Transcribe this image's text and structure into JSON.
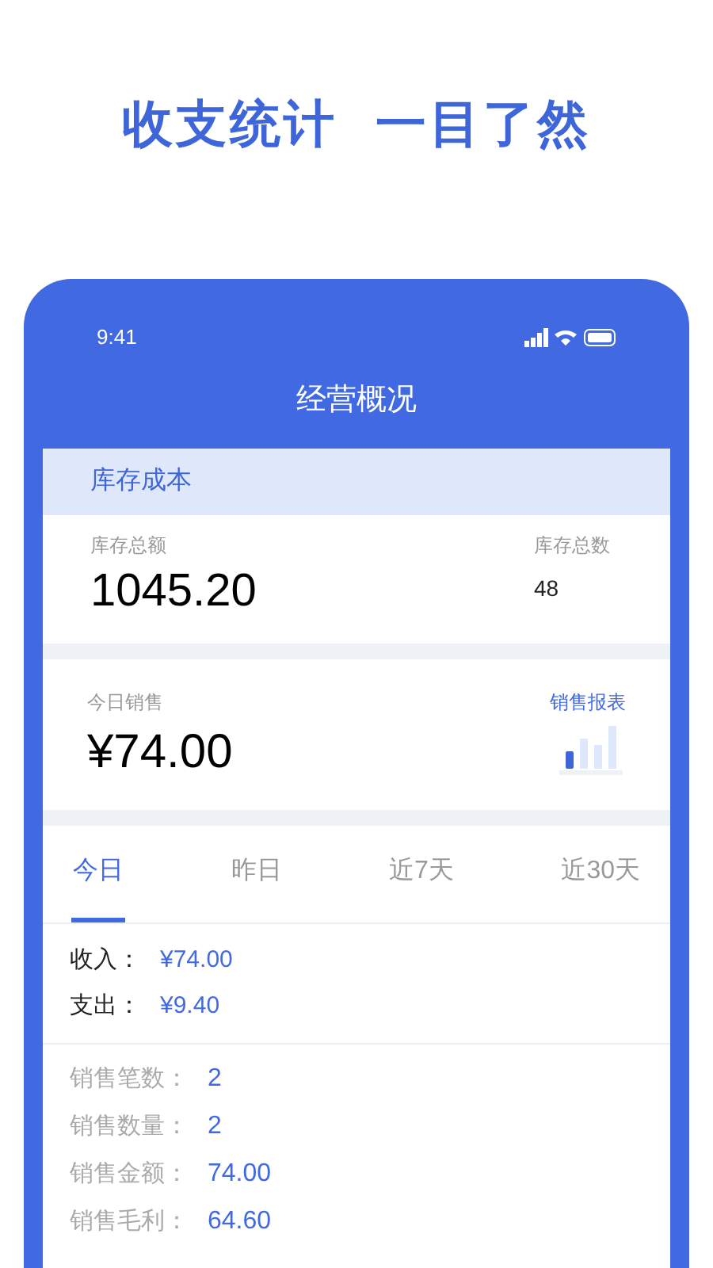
{
  "headline": [
    "收支统计",
    "一目了然"
  ],
  "status_bar": {
    "time": "9:41"
  },
  "nav_title": "经营概况",
  "inventory": {
    "title": "库存成本",
    "total_amount_label": "库存总额",
    "total_amount": "1045.20",
    "total_count_label": "库存总数",
    "total_count": "48"
  },
  "today_sales": {
    "label": "今日销售",
    "amount": "¥74.00",
    "report_link": "销售报表"
  },
  "tabs": [
    {
      "label": "今日",
      "selected": true
    },
    {
      "label": "昨日",
      "selected": false
    },
    {
      "label": "近7天",
      "selected": false
    },
    {
      "label": "近30天",
      "selected": false
    }
  ],
  "cashflow": [
    {
      "label": "收入：",
      "value": "¥74.00"
    },
    {
      "label": "支出：",
      "value": "¥9.40"
    }
  ],
  "stats": [
    {
      "label": "销售笔数：",
      "value": "2"
    },
    {
      "label": "销售数量：",
      "value": "2"
    },
    {
      "label": "销售金额：",
      "value": "74.00"
    },
    {
      "label": "销售毛利：",
      "value": "64.60"
    }
  ]
}
